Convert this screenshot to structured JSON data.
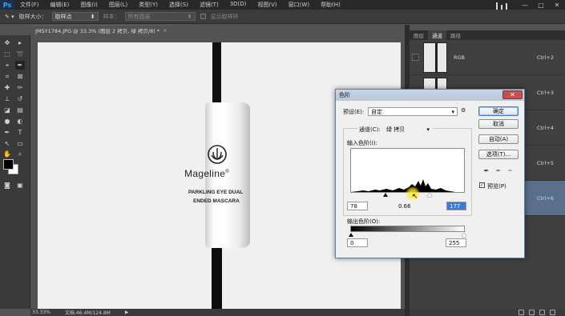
{
  "app": {
    "logo": "Ps"
  },
  "menubar": {
    "items": [
      "文件(F)",
      "编辑(E)",
      "图像(I)",
      "图层(L)",
      "类型(Y)",
      "选择(S)",
      "滤镜(T)",
      "3D(D)",
      "视图(V)",
      "窗口(W)",
      "帮助(H)"
    ],
    "window_buttons": [
      "—",
      "□",
      "✕"
    ]
  },
  "optionsbar": {
    "sample_size_label": "取样大小：",
    "sample_size_value": "取样点",
    "sample_label": "样本：",
    "sample_value": "所有图层",
    "show_ring_label": "显示取样环"
  },
  "document": {
    "tab_title": "JMSY1784.JPG @ 33.3% (图层 2 拷贝, 绿 拷贝/8) *",
    "brand_name": "Mageline",
    "brand_reg": "®",
    "tagline_1": "PARKLING EYE DUAL",
    "tagline_2": "ENDED MASCARA"
  },
  "statusbar": {
    "zoom": "33.33%",
    "doc_size": "文档:46.4M/124.8M"
  },
  "channels_panel": {
    "tabs": [
      "图层",
      "通道",
      "路径"
    ],
    "active_tab": 1,
    "rows": [
      {
        "name": "RGB",
        "shortcut": "Ctrl+2",
        "selected": false
      },
      {
        "name": "",
        "shortcut": "Ctrl+3",
        "selected": false
      },
      {
        "name": "",
        "shortcut": "Ctrl+4",
        "selected": false
      },
      {
        "name": "",
        "shortcut": "Ctrl+5",
        "selected": false
      },
      {
        "name": "",
        "shortcut": "Ctrl+6",
        "selected": true
      }
    ]
  },
  "levels_dialog": {
    "title": "色阶",
    "close": "✕",
    "preset_label": "预设(E):",
    "preset_value": "自定",
    "channel_label": "通道(C):",
    "channel_value": "绿 拷贝",
    "input_levels_label": "输入色阶(I):",
    "input_black": "78",
    "input_gamma": "0.66",
    "input_white": "177",
    "output_levels_label": "输出色阶(O):",
    "output_black": "0",
    "output_white": "255",
    "buttons": {
      "ok": "确定",
      "cancel": "取消",
      "auto": "自动(A)",
      "options": "选项(T)..."
    },
    "preview_label": "预览(P)",
    "preview_checked": true,
    "input_slider_positions": {
      "black": 78,
      "gamma_value": 0.66,
      "white": 177
    }
  },
  "colors": {
    "accent": "#3a7ad8",
    "selected_channel": "#5a6f8c",
    "dialog_title": "#b9c8da"
  }
}
